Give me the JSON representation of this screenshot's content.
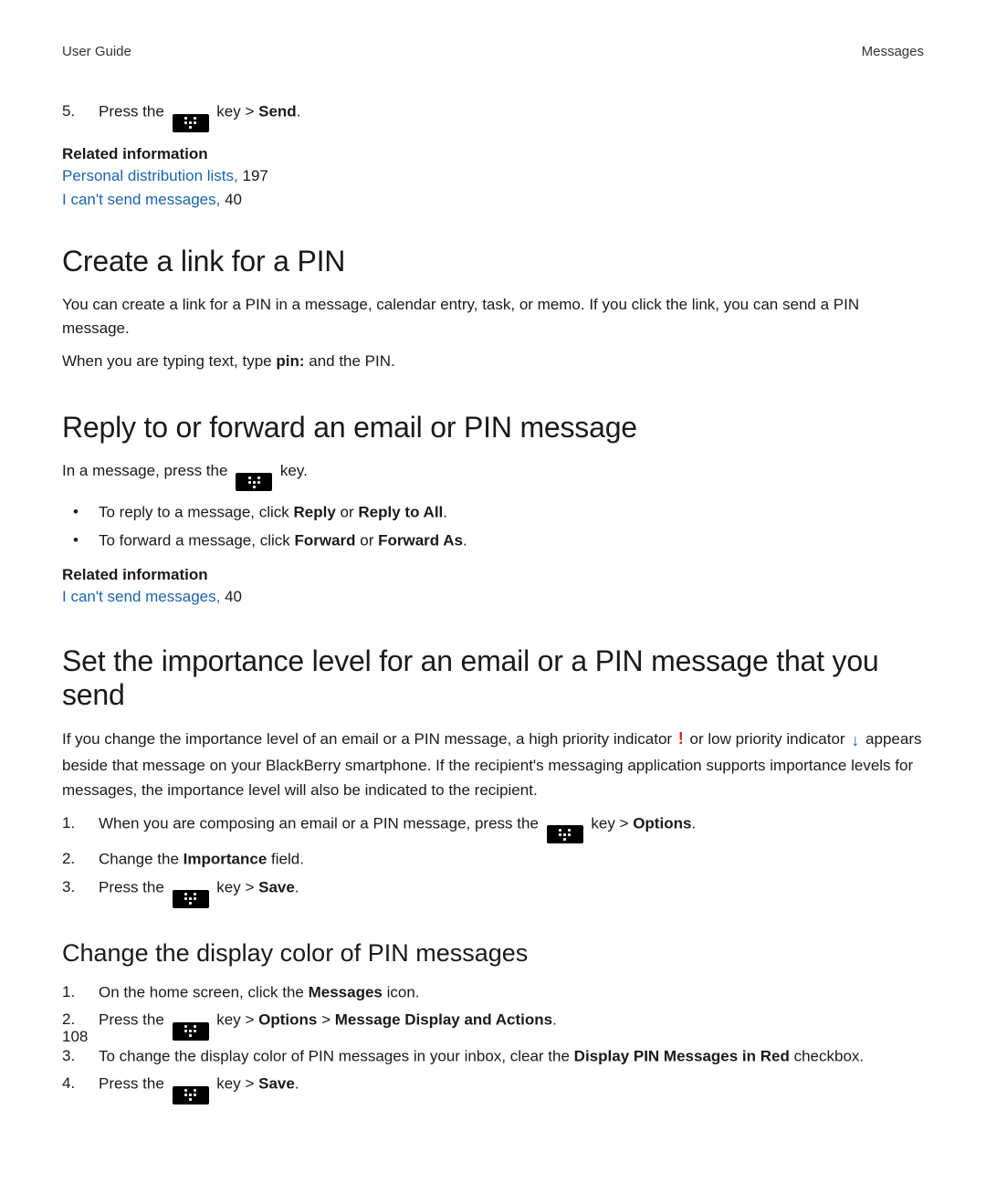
{
  "header": {
    "left": "User Guide",
    "right": "Messages"
  },
  "intro_steps": [
    {
      "n": "5.",
      "pre": "Press the ",
      "post": " key > ",
      "action": "Send",
      "tail": "."
    }
  ],
  "related1": {
    "heading": "Related information",
    "links": [
      {
        "text": "Personal distribution lists,",
        "pg": " 197"
      },
      {
        "text": "I can't send messages,",
        "pg": " 40"
      }
    ]
  },
  "sec1": {
    "title": "Create a link for a PIN",
    "p1": "You can create a link for a PIN in a message, calendar entry, task, or memo. If you click the link, you can send a PIN message.",
    "p2a": "When you are typing text, type ",
    "p2b": "pin:",
    "p2c": " and the PIN."
  },
  "sec2": {
    "title": "Reply to or forward an email or PIN message",
    "lead_pre": "In a message, press the ",
    "lead_post": " key.",
    "bullets": [
      {
        "pre": "To reply to a message, click ",
        "b1": "Reply",
        "mid": " or ",
        "b2": "Reply to All",
        "tail": "."
      },
      {
        "pre": "To forward a message, click ",
        "b1": "Forward",
        "mid": " or ",
        "b2": "Forward As",
        "tail": "."
      }
    ],
    "related": {
      "heading": "Related information",
      "link": {
        "text": "I can't send messages,",
        "pg": " 40"
      }
    }
  },
  "sec3": {
    "title": "Set the importance level for an email or a PIN message that you send",
    "p_a": "If you change the importance level of an email or a PIN message, a high priority indicator ",
    "p_b": " or low priority indicator ",
    "p_c": " appears beside that message on your BlackBerry smartphone. If the recipient's messaging application supports importance levels for messages, the importance level will also be indicated to the recipient.",
    "steps": [
      {
        "n": "1.",
        "pre": "When you are composing an email or a PIN message, press the ",
        "post": " key > ",
        "action": "Options",
        "tail": ".",
        "has_key": true
      },
      {
        "n": "2.",
        "full_pre": "Change the ",
        "full_b": "Importance",
        "full_post": " field.",
        "has_key": false
      },
      {
        "n": "3.",
        "pre": "Press the ",
        "post": " key > ",
        "action": "Save",
        "tail": ".",
        "has_key": true
      }
    ]
  },
  "sec4": {
    "title": "Change the display color of PIN messages",
    "steps": [
      {
        "n": "1.",
        "full_pre": "On the home screen, click the ",
        "full_b": "Messages",
        "full_post": " icon.",
        "has_key": false
      },
      {
        "n": "2.",
        "pre": "Press the ",
        "post": " key > ",
        "action": "Options",
        "mid": " > ",
        "action2": "Message Display and Actions",
        "tail": ".",
        "has_key": true
      },
      {
        "n": "3.",
        "full_pre": "To change the display color of PIN messages in your inbox, clear the ",
        "full_b": "Display PIN Messages in Red",
        "full_post": " checkbox.",
        "has_key": false
      },
      {
        "n": "4.",
        "pre": "Press the ",
        "post": " key > ",
        "action": "Save",
        "tail": ".",
        "has_key": true
      }
    ]
  },
  "page_number": "108",
  "icons": {
    "hi": "!",
    "lo": "↓",
    "bullet": "•"
  }
}
